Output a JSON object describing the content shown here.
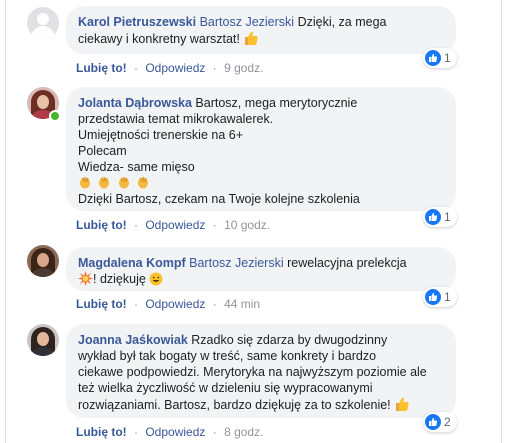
{
  "comments": [
    {
      "author": "Karol Pietruszewski",
      "mention": "Bartosz Jezierski",
      "lines": [
        "Dzięki, za mega",
        "ciekawy i konkretny warsztat!"
      ],
      "reaction_count": "1",
      "like_label": "Lubię to!",
      "reply_label": "Odpowiedz",
      "time": "9 godz."
    },
    {
      "author": "Jolanta Dąbrowska",
      "lines": [
        "Bartosz, mega merytorycznie",
        "przedstawia temat mikrokawalerek.",
        "Umiejętności trenerskie na 6+",
        "Polecam",
        "Wiedza- same mięso",
        "Dzięki Bartosz, czekam na Twoje kolejne szkolenia"
      ],
      "reaction_count": "1",
      "like_label": "Lubię to!",
      "reply_label": "Odpowiedz",
      "time": "10 godz."
    },
    {
      "author": "Magdalena Kompf",
      "mention": "Bartosz Jezierski",
      "lines": [
        "rewelacyjna prelekcja",
        "! dziękuję"
      ],
      "reaction_count": "1",
      "like_label": "Lubię to!",
      "reply_label": "Odpowiedz",
      "time": "44 min"
    },
    {
      "author": "Joanna Jaśkowiak",
      "lines": [
        "Rzadko się zdarza by dwugodzinny",
        "wykład był tak bogaty w treść, same konkrety i bardzo",
        "ciekawe podpowiedzi. Merytoryka na najwyższym poziomie ale",
        "też wielka życzliwość w dzieleniu się wypracowanymi",
        "rozwiązaniami. Bartosz, bardzo dziękuję za to szkolenie!"
      ],
      "reaction_count": "2",
      "like_label": "Lubię to!",
      "reply_label": "Odpowiedz",
      "time": "8 godz."
    }
  ],
  "separator": "·",
  "colors": {
    "link": "#385898",
    "bubble": "#f2f3f5",
    "meta": "#90949c",
    "like_blue": "#1877f2",
    "online": "#42b72a"
  }
}
